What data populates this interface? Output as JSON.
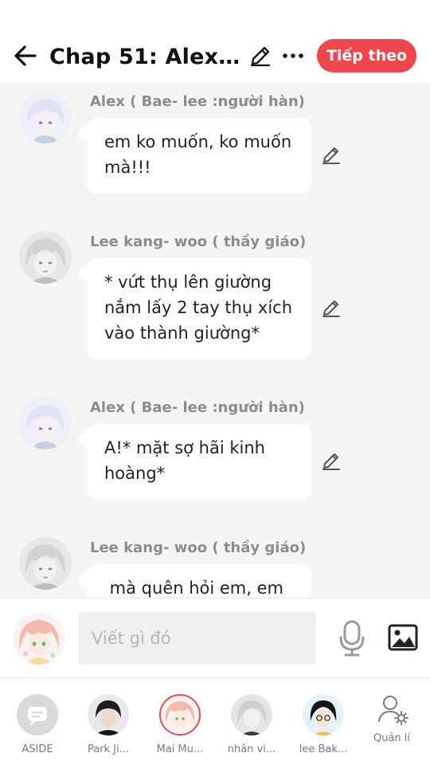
{
  "header": {
    "title": "Chap 51: Alex v...",
    "next_label": "Tiếp theo",
    "accent_color": "#f0464d"
  },
  "messages": [
    {
      "name": "Alex (  Bae- lee :người hàn)",
      "text": "em ko muốn, ko muốn mà!!!",
      "avatar": "alex-avatar"
    },
    {
      "name": "Lee kang- woo ( thầy giáo)",
      "text": "* vứt thụ lên giường nắm lấy 2 tay thụ xích vào thành giường*",
      "avatar": "lee-avatar"
    },
    {
      "name": "Alex (  Bae- lee :người hàn)",
      "text": "A!* mặt sợ hãi kinh hoàng*",
      "avatar": "alex-avatar"
    },
    {
      "name": "Lee kang- woo ( thầy giáo)",
      "text": " mà quên hỏi em, em",
      "avatar": "lee-avatar"
    }
  ],
  "input": {
    "placeholder": "Viết gì đó"
  },
  "tabs": [
    {
      "label": "ASIDE",
      "icon": "chat-bubble-icon"
    },
    {
      "label": "Park Ji...",
      "icon": "avatar"
    },
    {
      "label": "Mai Mu...",
      "icon": "avatar"
    },
    {
      "label": "nhân vi...",
      "icon": "avatar"
    },
    {
      "label": "lee Bak...",
      "icon": "avatar"
    },
    {
      "label": "Quản lí",
      "icon": "user-settings-icon"
    }
  ]
}
